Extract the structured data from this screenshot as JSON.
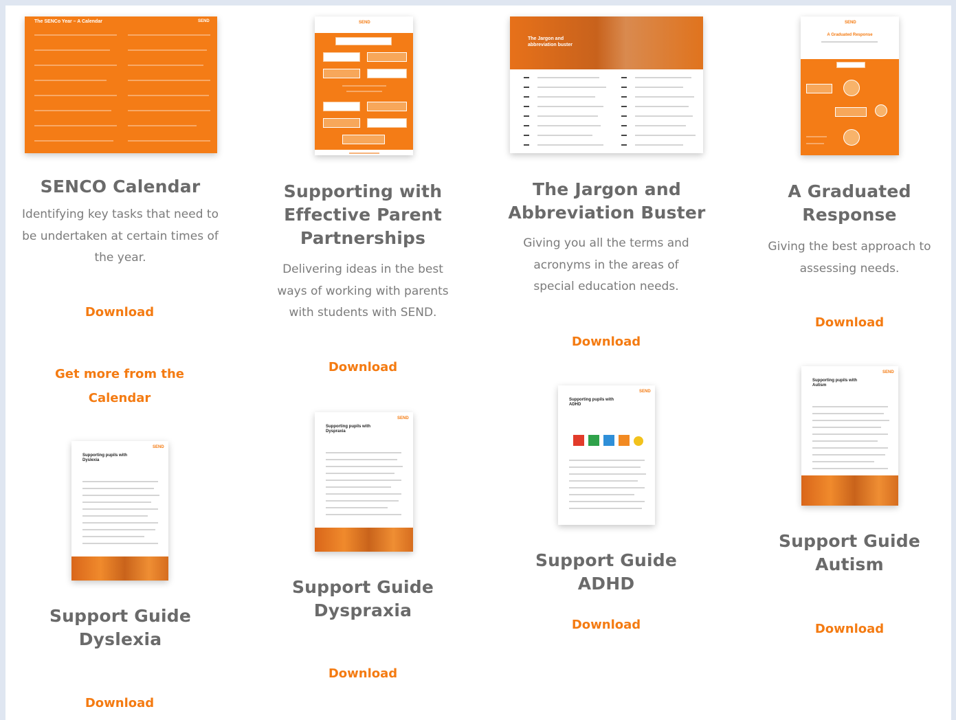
{
  "colors": {
    "accent": "#f47b12",
    "title": "#6a6a6a",
    "text": "#7b7b7b",
    "background": "#dfe6f1"
  },
  "resources": {
    "senco": {
      "title": "SENCO Calendar",
      "description": "Identifying key tasks that need to be undertaken at certain times of the year.",
      "download": "Download",
      "more": "Get more from the Calendar",
      "thumb_heading": "The SENCo Year – A Calendar"
    },
    "parent": {
      "title": "Supporting with Effective Parent Partnerships",
      "description": "Delivering ideas in the best ways of working with parents with students with SEND.",
      "download": "Download"
    },
    "jargon": {
      "title": "The Jargon and Abbreviation Buster",
      "description": "Giving you all the terms and acronyms in the areas of special education needs.",
      "download": "Download",
      "thumb_heading": "The Jargon and abbreviation buster"
    },
    "graduated": {
      "title": "A Graduated Response",
      "description": "Giving the best approach to assessing needs.",
      "download": "Download",
      "thumb_heading": "A Graduated Response"
    },
    "dyslexia": {
      "title": "Support Guide Dyslexia",
      "download": "Download",
      "thumb_heading": "Supporting pupils with Dyslexia"
    },
    "dyspraxia": {
      "title": "Support Guide Dyspraxia",
      "download": "Download",
      "thumb_heading": "Supporting pupils with Dyspraxia"
    },
    "adhd": {
      "title": "Support Guide ADHD",
      "download": "Download",
      "thumb_heading": "Supporting pupils with ADHD"
    },
    "autism": {
      "title": "Support Guide Autism",
      "download": "Download",
      "thumb_heading": "Supporting pupils with Autism"
    }
  },
  "brand": {
    "logo_text": "SEND"
  },
  "icons": {
    "logo": "send-logo-icon"
  }
}
